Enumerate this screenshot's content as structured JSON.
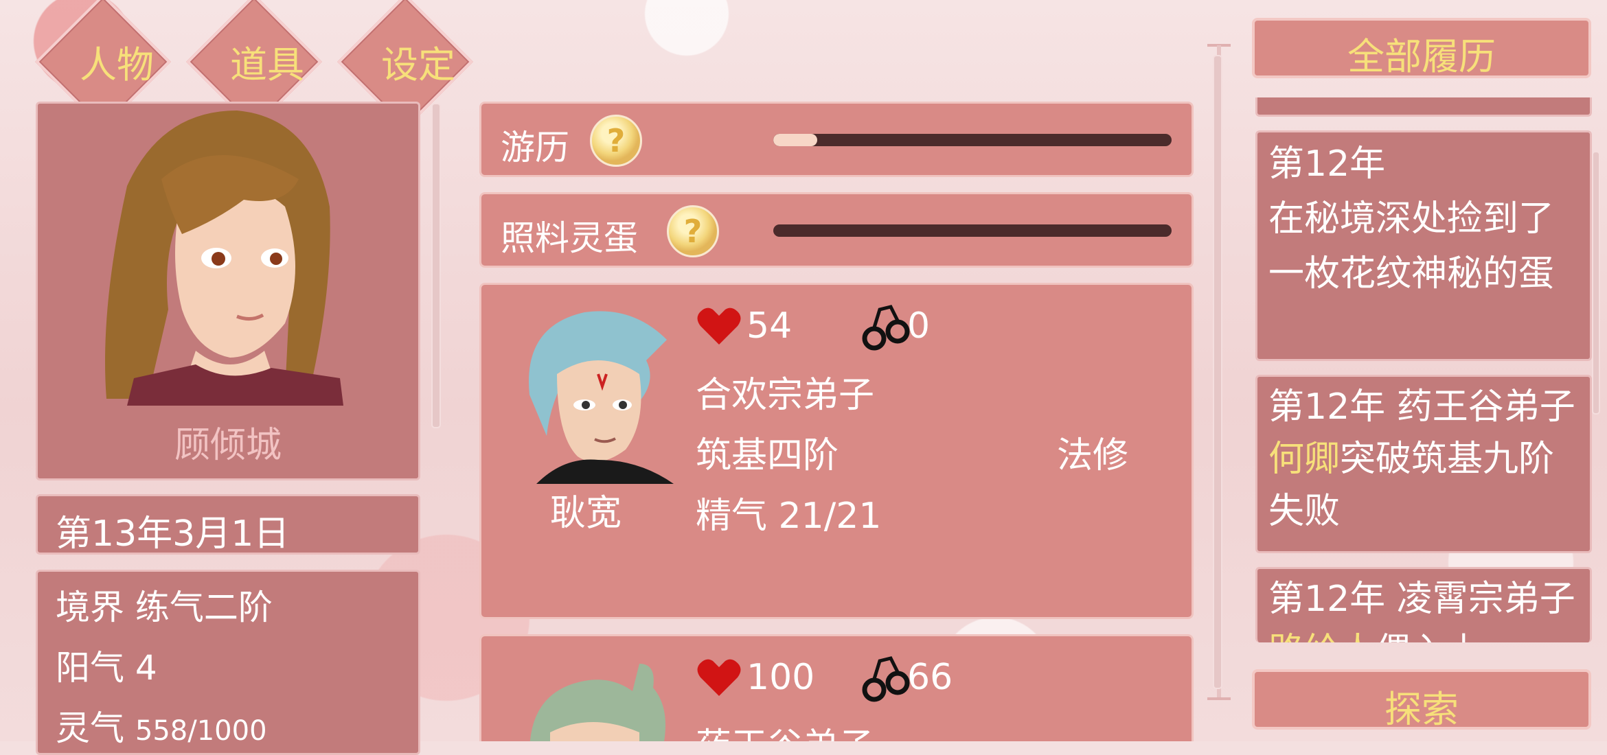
{
  "tabs": [
    {
      "label": "人物"
    },
    {
      "label": "道具"
    },
    {
      "label": "设定"
    }
  ],
  "player": {
    "name": "顾倾城",
    "date": "第13年3月1日",
    "stats": {
      "realm_label": "境界",
      "realm_value": "练气二阶",
      "yang_label": "阳气",
      "yang_value": "4",
      "spirit_label": "灵气",
      "spirit_value": "558/1000"
    }
  },
  "tasks": [
    {
      "label": "游历",
      "help_icon": "?",
      "progress": 0.1
    },
    {
      "label": "照料灵蛋",
      "help_icon": "?",
      "progress": 0.0
    }
  ],
  "characters": [
    {
      "name": "耿宽",
      "affection": "54",
      "bondage": "0",
      "sect": "合欢宗弟子",
      "level": "筑基四阶",
      "role": "法修",
      "essence_label": "精气",
      "essence_value": "21/21"
    },
    {
      "affection": "100",
      "bondage": "66",
      "sect": "药王谷弟子"
    }
  ],
  "history": {
    "title": "全部履历",
    "items": [
      {
        "text_parts": [
          {
            "t": "第12年"
          },
          {
            "t": "在秘境深处捡到了一枚花纹神秘的蛋"
          }
        ]
      },
      {
        "text_parts": [
          {
            "t": "第12年 药王谷弟子"
          },
          {
            "t": "何卿",
            "highlight": true
          },
          {
            "t": "突破筑基九阶失败"
          }
        ]
      },
      {
        "text_parts": [
          {
            "t": "第12年 凌霄宗弟子"
          },
          {
            "t": "路给人",
            "highlight": true
          },
          {
            "t": "偶入上"
          }
        ]
      }
    ]
  },
  "explore": {
    "label": "探索"
  },
  "colors": {
    "accent_yellow": "#f7e07a",
    "panel_pink": "#c27b7b",
    "card_pink": "#d98a86",
    "heart_red": "#d11414"
  }
}
